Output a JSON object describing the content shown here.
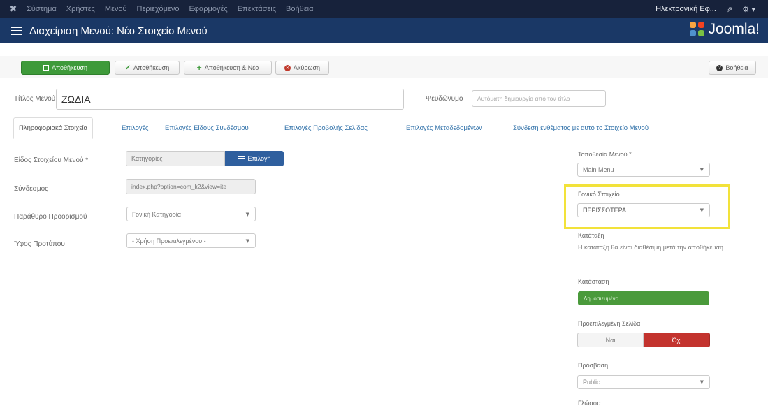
{
  "topnav": {
    "menu": [
      "Σύστημα",
      "Χρήστες",
      "Μενού",
      "Περιεχόμενο",
      "Εφαρμογές",
      "Επεκτάσεις",
      "Βοήθεια"
    ],
    "site_link": "Ηλεκτρονική Εφ..."
  },
  "header": {
    "title": "Διαχείριση Μενού: Νέο Στοιχείο Μενού",
    "brand": "Joomla!"
  },
  "toolbar": {
    "save_close": "Αποθήκευση",
    "save": "Αποθήκευση",
    "save_new": "Αποθήκευση & Νέο",
    "cancel": "Ακύρωση",
    "help": "Βοήθεια"
  },
  "form": {
    "title_label": "Τίτλος Μενού *",
    "title_value": "ΖΩΔΙΑ",
    "alias_label": "Ψευδώνυμο",
    "alias_placeholder": "Αυτόματη δημιουργία από τον τίτλο"
  },
  "tabs": [
    "Πληροφοριακά Στοιχεία",
    "Επιλογές",
    "Επιλογές Είδους Συνδέσμου",
    "Επιλογές Προβολής Σελίδας",
    "Επιλογές Μεταδεδομένων",
    "Σύνδεση ενθέματος με αυτό το Στοιχείο Μενού"
  ],
  "details": {
    "type_label": "Είδος Στοιχείου Μενού *",
    "type_value": "Κατηγορίες",
    "type_button": "Επιλογή",
    "link_label": "Σύνδεσμος",
    "link_value": "index.php?option=com_k2&view=ite",
    "target_label": "Παράθυρο Προορισμού",
    "target_value": "Γονική Κατηγορία",
    "style_label": "Ύφος Προτύπου",
    "style_value": "- Χρήση Προεπιλεγμένου -"
  },
  "side": {
    "menu_label": "Τοποθεσία Μενού *",
    "menu_value": "Main Menu",
    "parent_label": "Γονικό Στοιχείο",
    "parent_value": "ΠΕΡΙΣΣΟΤΕΡΑ",
    "ordering_label": "Κατάταξη",
    "ordering_note": "Η κατάταξη θα είναι διαθέσιμη μετά την αποθήκευση",
    "status_label": "Κατάσταση",
    "status_value": "Δημοσιευμένο",
    "home_label": "Προεπιλεγμένη Σελίδα",
    "home_yes": "Ναι",
    "home_no": "Όχι",
    "access_label": "Πρόσβαση",
    "access_value": "Public",
    "language_label": "Γλώσσα"
  }
}
